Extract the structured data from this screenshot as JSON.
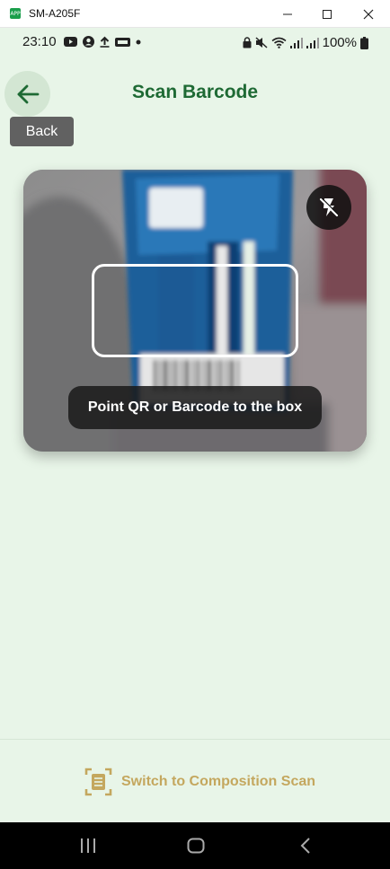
{
  "window": {
    "title": "SM-A205F",
    "app_icon_text": "APP"
  },
  "status_bar": {
    "time": "23:10",
    "battery": "100%"
  },
  "header": {
    "title": "Scan Barcode",
    "back_tooltip": "Back"
  },
  "camera": {
    "hint": "Point QR or Barcode to the box"
  },
  "bottom": {
    "switch_label": "Switch to Composition Scan"
  },
  "colors": {
    "background": "#e8f5e8",
    "title": "#1e6a34",
    "accent_gold": "#c4a75e"
  },
  "icons": [
    "back-arrow-icon",
    "flash-off-icon",
    "composition-scan-icon",
    "recents-icon",
    "home-icon",
    "nav-back-icon"
  ]
}
